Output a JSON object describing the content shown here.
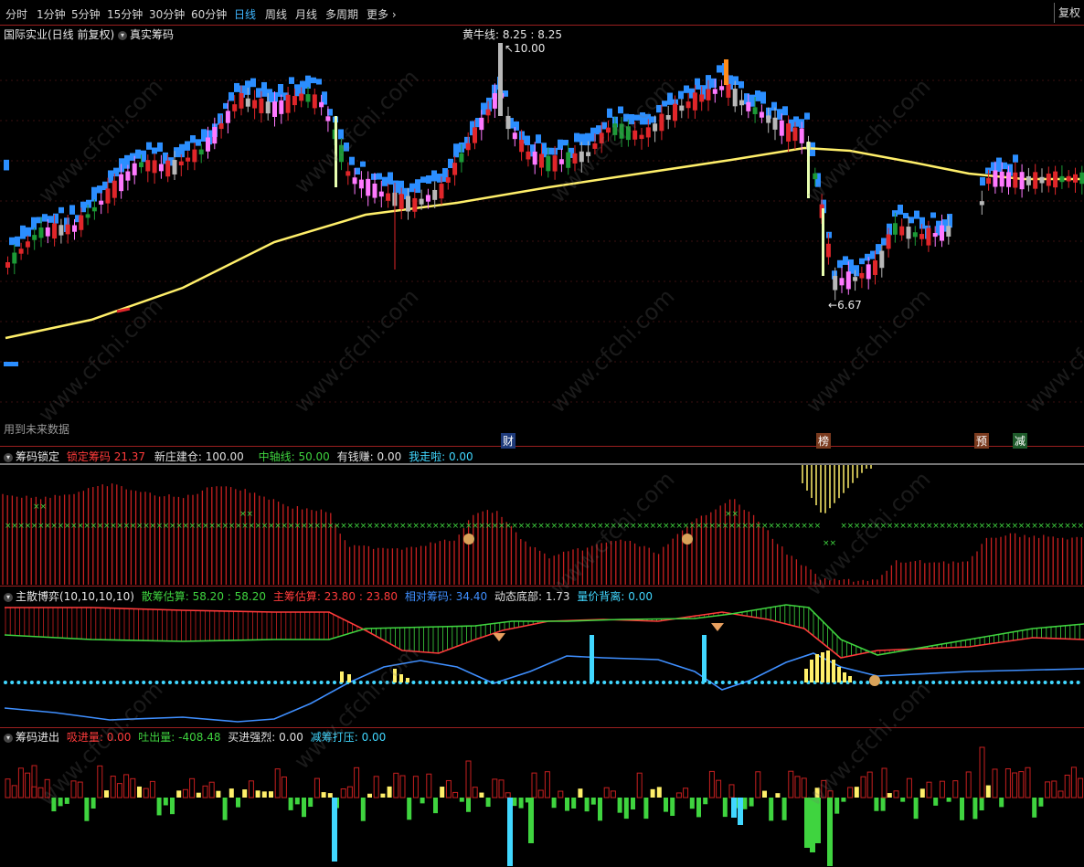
{
  "toolbar": {
    "tabs": [
      "分时",
      "1分钟",
      "5分钟",
      "15分钟",
      "30分钟",
      "60分钟",
      "日线",
      "周线",
      "月线",
      "多周期",
      "更多"
    ],
    "active_tab": "日线",
    "more_glyph": "›",
    "right_button": "复权"
  },
  "main_panel": {
    "title": "国际实业(日线 前复权)",
    "indicator": "真实筹码",
    "legend_label": "黄牛线: 8.25",
    "legend_value": ": 8.25",
    "high_label": "10.00",
    "low_label": "6.67",
    "future_note": "用到未来数据",
    "markers": [
      "财",
      "榜",
      "预",
      "减"
    ]
  },
  "panel2": {
    "name": "筹码锁定",
    "items": [
      {
        "label": "锁定筹码",
        "value": "21.37",
        "color": "#ff3b3b"
      },
      {
        "label": "新庄建仓:",
        "value": "100.00",
        "color": "#e0e0e0"
      },
      {
        "label": "中轴线:",
        "value": "50.00",
        "color": "#3fd43f"
      },
      {
        "label": "有钱赚:",
        "value": "0.00",
        "color": "#e0e0e0"
      },
      {
        "label": "我走啦:",
        "value": "0.00",
        "color": "#41d7ff"
      }
    ]
  },
  "panel3": {
    "name": "主散博弈(10,10,10,10)",
    "items": [
      {
        "label": "散筹估算:",
        "value": "58.20 : 58.20",
        "color": "#3fd43f"
      },
      {
        "label": "主筹估算:",
        "value": "23.80 : 23.80",
        "color": "#ff3b3b"
      },
      {
        "label": "相对筹码:",
        "value": "34.40",
        "color": "#3f8fff"
      },
      {
        "label": "动态底部:",
        "value": "1.73",
        "color": "#e0e0e0"
      },
      {
        "label": "量价背离:",
        "value": "0.00",
        "color": "#41d7ff"
      }
    ]
  },
  "panel4": {
    "name": "筹码进出",
    "items": [
      {
        "label": "吸进量:",
        "value": "0.00",
        "color": "#ff3b3b"
      },
      {
        "label": "吐出量:",
        "value": "-408.48",
        "color": "#3fd43f"
      },
      {
        "label": "买进强烈:",
        "value": "0.00",
        "color": "#e0e0e0"
      },
      {
        "label": "减筹打压:",
        "value": "0.00",
        "color": "#41d7ff"
      }
    ]
  },
  "watermark": "www.cfchi.com",
  "colors": {
    "up": "#e0262a",
    "down": "#1c9a36",
    "neutral": "#b8b8b8",
    "magenta": "#ff79ff",
    "blue": "#2b8eff",
    "yellow_line": "#ffef6a",
    "green": "#3fd43f",
    "cyan": "#41d7ff"
  },
  "chart_data": {
    "type": "candlestick",
    "price_high": 10.0,
    "price_low": 6.67,
    "yellow_line_last": 8.25
  }
}
